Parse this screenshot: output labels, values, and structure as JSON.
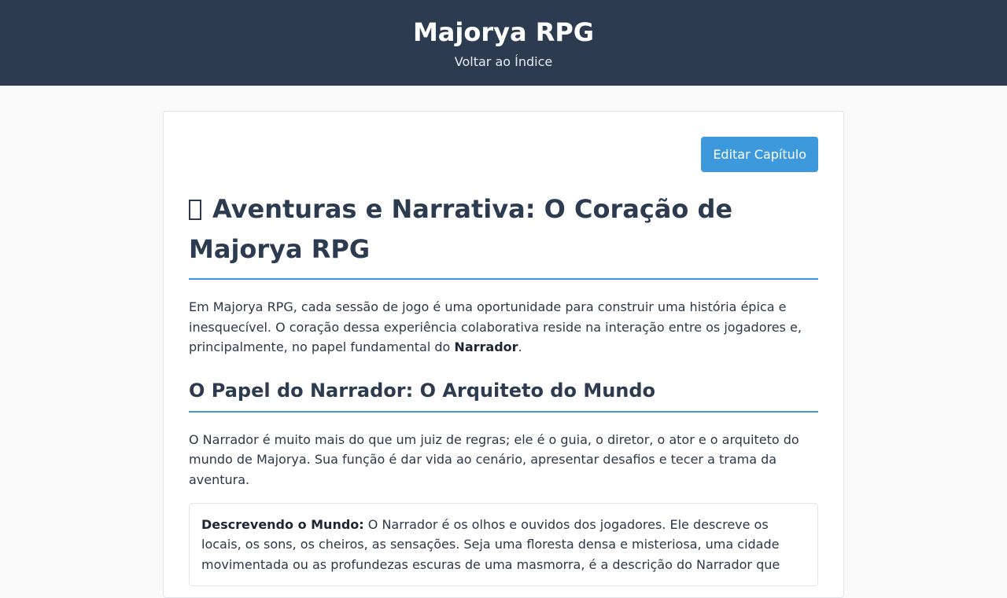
{
  "header": {
    "site_title": "Majorya RPG",
    "back_link": "Voltar ao Índice"
  },
  "toolbar": {
    "edit_label": "Editar Capítulo"
  },
  "article": {
    "title": "Aventuras e Narrativa: O Coração de Majorya RPG",
    "intro_text": "Em Majorya RPG, cada sessão de jogo é uma oportunidade para construir uma história épica e inesquecível. O coração dessa experiência colaborativa reside na interação entre os jogadores e, principalmente, no papel fundamental do ",
    "intro_bold": "Narrador",
    "intro_end": ".",
    "section_title": "O Papel do Narrador: O Arquiteto do Mundo",
    "section_text": "O Narrador é muito mais do que um juiz de regras; ele é o guia, o diretor, o ator e o arquiteto do mundo de Majorya. Sua função é dar vida ao cenário, apresentar desafios e tecer a trama da aventura.",
    "box_bold": "Descrevendo o Mundo:",
    "box_text": " O Narrador é os olhos e ouvidos dos jogadores. Ele descreve os locais, os sons, os cheiros, as sensações. Seja uma floresta densa e misteriosa, uma cidade movimentada ou as profundezas escuras de uma masmorra, é a descrição do Narrador que"
  }
}
